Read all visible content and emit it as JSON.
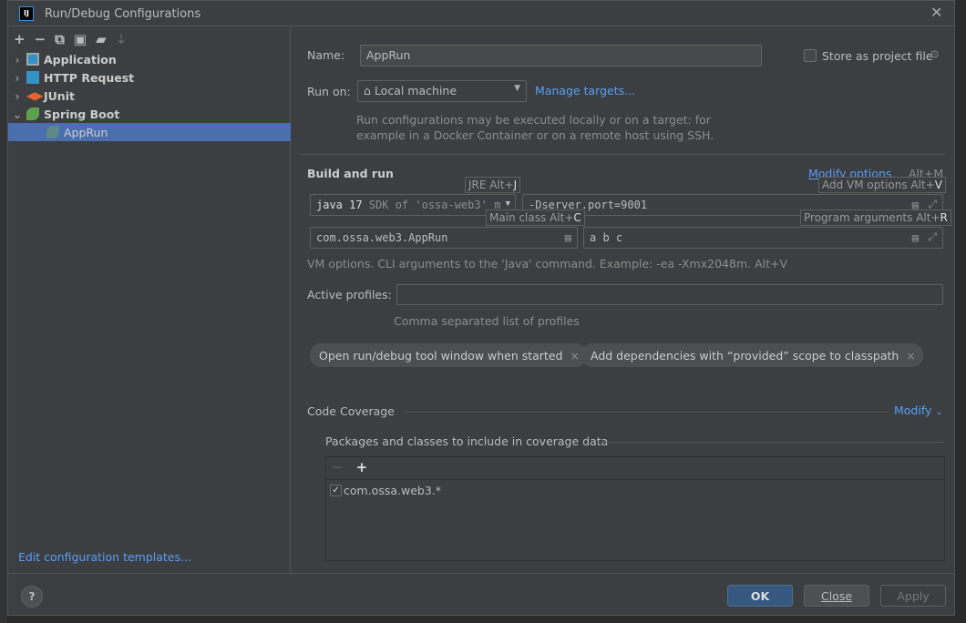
{
  "window": {
    "title": "Run/Debug Configurations"
  },
  "toolbar": {
    "icons": [
      "plus-icon",
      "minus-icon",
      "copy-icon",
      "save-icon",
      "new-folder-icon",
      "sort-icon"
    ]
  },
  "tree": [
    {
      "label": "Application",
      "expanded": false
    },
    {
      "label": "HTTP Request",
      "expanded": false
    },
    {
      "label": "JUnit",
      "expanded": false
    },
    {
      "label": "Spring Boot",
      "expanded": true
    },
    {
      "label": "AppRun",
      "selected": true
    }
  ],
  "edit_templates": "Edit configuration templates...",
  "form": {
    "name_label": "Name:",
    "name_value": "AppRun",
    "store_label": "Store as project file",
    "store_checked": false,
    "runon_label": "Run on:",
    "runon_value": "Local machine",
    "manage_targets": "Manage targets...",
    "runon_hint1": "Run configurations may be executed locally or on a target: for",
    "runon_hint2": "example in a Docker Container or on a remote host using SSH.",
    "build_title": "Build and run",
    "modify_options": "Modify options",
    "modify_shortcut": "Alt+M",
    "jre_bold": "java 17",
    "jre_dim": " SDK of 'ossa-web3' m",
    "vm_options": "-Dserver.port=9001",
    "main_class": "com.ossa.web3.AppRun",
    "program_args": "a b c",
    "tip_jre": "JRE Alt+",
    "tip_jre_key": "J",
    "tip_vm": "Add VM options Alt+",
    "tip_vm_key": "V",
    "tip_main": "Main class Alt+",
    "tip_main_key": "C",
    "tip_args": "Program arguments Alt+",
    "tip_args_key": "R",
    "vm_hint": "VM options. CLI arguments to the 'Java' command. Example: -ea -Xmx2048m. Alt+V",
    "profiles_label": "Active profiles:",
    "profiles_value": "",
    "profiles_hint": "Comma separated list of profiles",
    "chips": [
      "Open run/debug tool window when started",
      "Add dependencies with “provided” scope to classpath"
    ]
  },
  "coverage": {
    "title": "Code Coverage",
    "modify": "Modify",
    "packages_title": "Packages and classes to include in coverage data",
    "items": [
      {
        "label": "com.ossa.web3.*",
        "checked": true
      }
    ]
  },
  "footer": {
    "ok": "OK",
    "close": "Close",
    "apply": "Apply",
    "help": "?"
  },
  "colors": {
    "accent": "#589df6",
    "selection": "#4b6eaf",
    "ok_button": "#365880"
  }
}
